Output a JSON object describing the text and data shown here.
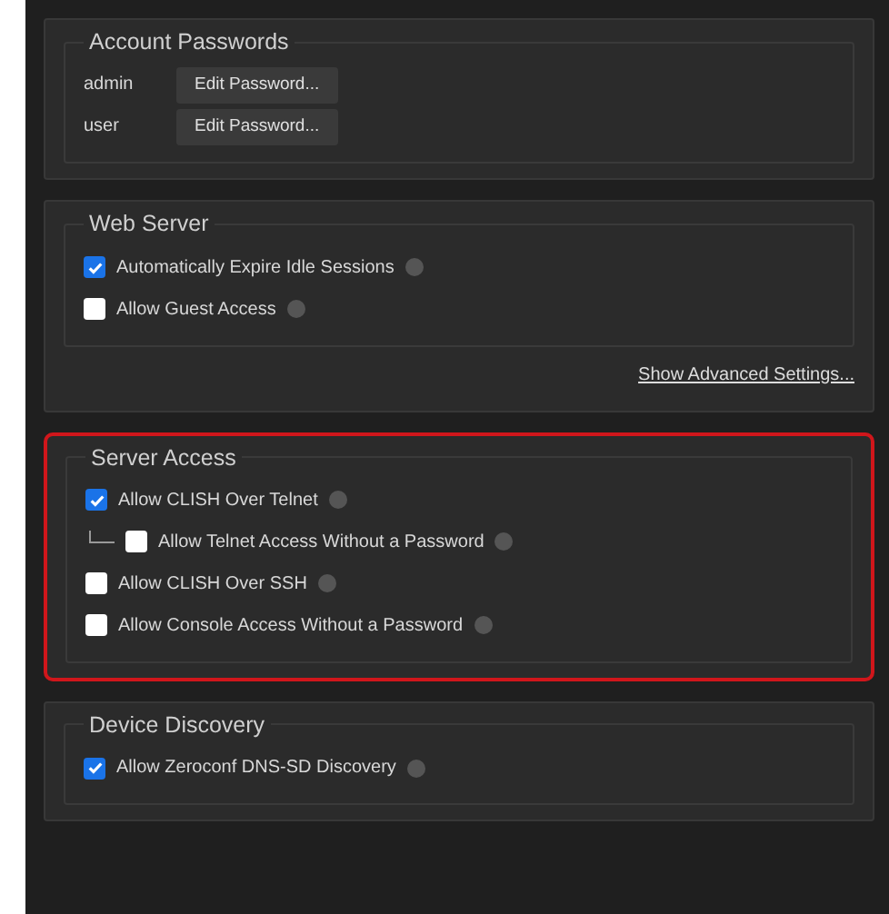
{
  "sections": [
    {
      "kind": "accounts",
      "title": "Account Passwords",
      "highlighted": false,
      "accounts": [
        {
          "user": "admin",
          "button": "Edit Password..."
        },
        {
          "user": "user",
          "button": "Edit Password..."
        }
      ]
    },
    {
      "kind": "options",
      "title": "Web Server",
      "highlighted": false,
      "options": [
        {
          "label": "Automatically Expire Idle Sessions",
          "checked": true
        },
        {
          "label": "Allow Guest Access",
          "checked": false
        }
      ],
      "link": "Show Advanced Settings..."
    },
    {
      "kind": "options",
      "title": "Server Access",
      "highlighted": true,
      "options": [
        {
          "label": "Allow CLISH Over Telnet",
          "checked": true,
          "children": [
            {
              "label": "Allow Telnet Access Without a Password",
              "checked": false
            }
          ]
        },
        {
          "label": "Allow CLISH Over SSH",
          "checked": false
        },
        {
          "label": "Allow Console Access Without a Password",
          "checked": false
        }
      ]
    },
    {
      "kind": "options",
      "title": "Device Discovery",
      "highlighted": false,
      "options": [
        {
          "label": "Allow Zeroconf DNS-SD Discovery",
          "checked": true
        }
      ]
    }
  ]
}
